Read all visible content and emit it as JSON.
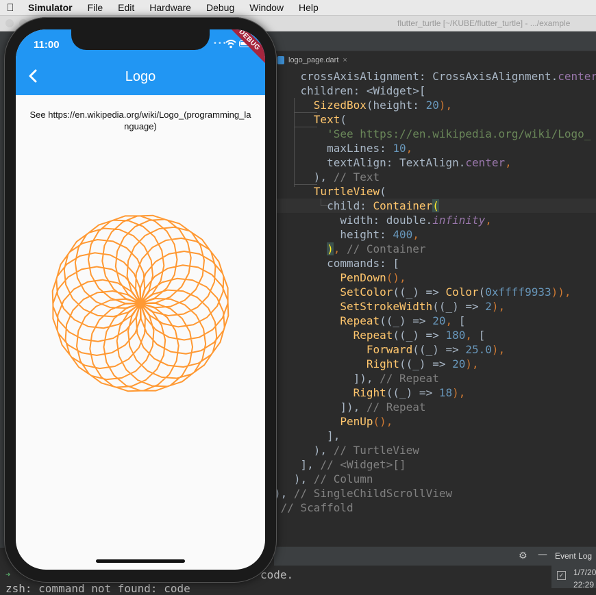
{
  "menubar": {
    "items": [
      "Simulator",
      "File",
      "Edit",
      "Hardware",
      "Debug",
      "Window",
      "Help"
    ]
  },
  "ide": {
    "window_title": "flutter_turtle [~/KUBE/flutter_turtle] - .../example",
    "tab_label": "logo_page.dart",
    "code_lines": [
      [
        {
          "t": "    crossAxisAlignment: CrossAxisAlignment.",
          "c": ""
        },
        {
          "t": "center",
          "c": "c-const"
        },
        {
          "t": ",",
          "c": "c-kw"
        }
      ],
      [
        {
          "t": "    children: <Widget>[",
          "c": ""
        }
      ],
      [
        {
          "t": "      ",
          "c": ""
        },
        {
          "t": "SizedBox",
          "c": "c-cls"
        },
        {
          "t": "(height: ",
          "c": ""
        },
        {
          "t": "20",
          "c": "c-num"
        },
        {
          "t": "),",
          "c": "c-kw"
        }
      ],
      [
        {
          "t": "      ",
          "c": ""
        },
        {
          "t": "Text",
          "c": "c-cls"
        },
        {
          "t": "(",
          "c": ""
        }
      ],
      [
        {
          "t": "        ",
          "c": ""
        },
        {
          "t": "'See https://en.wikipedia.org/wiki/Logo_",
          "c": "c-str"
        }
      ],
      [
        {
          "t": "        maxLines: ",
          "c": ""
        },
        {
          "t": "10",
          "c": "c-num"
        },
        {
          "t": ",",
          "c": "c-kw"
        }
      ],
      [
        {
          "t": "        textAlign: TextAlign.",
          "c": ""
        },
        {
          "t": "center",
          "c": "c-const"
        },
        {
          "t": ",",
          "c": "c-kw"
        }
      ],
      [
        {
          "t": "      ), ",
          "c": ""
        },
        {
          "t": "// Text",
          "c": "c-cmt"
        }
      ],
      [
        {
          "t": "      ",
          "c": ""
        },
        {
          "t": "TurtleView",
          "c": "c-cls"
        },
        {
          "t": "(",
          "c": ""
        }
      ],
      [
        {
          "t": "        child: ",
          "c": ""
        },
        {
          "t": "Container",
          "c": "c-cls"
        },
        {
          "t": "(",
          "c": "c-bracket"
        }
      ],
      [
        {
          "t": "          width: double.",
          "c": ""
        },
        {
          "t": "infinity",
          "c": "c-ital"
        },
        {
          "t": ",",
          "c": "c-kw"
        }
      ],
      [
        {
          "t": "          height: ",
          "c": ""
        },
        {
          "t": "400",
          "c": "c-num"
        },
        {
          "t": ",",
          "c": "c-kw"
        }
      ],
      [
        {
          "t": "        ",
          "c": ""
        },
        {
          "t": ")",
          "c": "c-bracket"
        },
        {
          "t": ", ",
          "c": "c-kw"
        },
        {
          "t": "// Container",
          "c": "c-cmt"
        }
      ],
      [
        {
          "t": "        commands: [",
          "c": ""
        }
      ],
      [
        {
          "t": "          ",
          "c": ""
        },
        {
          "t": "PenDown",
          "c": "c-cls"
        },
        {
          "t": "(),",
          "c": "c-kw"
        }
      ],
      [
        {
          "t": "          ",
          "c": ""
        },
        {
          "t": "SetColor",
          "c": "c-cls"
        },
        {
          "t": "((_) => ",
          "c": ""
        },
        {
          "t": "Color",
          "c": "c-cls"
        },
        {
          "t": "(",
          "c": ""
        },
        {
          "t": "0xffff9933",
          "c": "c-num"
        },
        {
          "t": ")),",
          "c": "c-kw"
        }
      ],
      [
        {
          "t": "          ",
          "c": ""
        },
        {
          "t": "SetStrokeWidth",
          "c": "c-cls"
        },
        {
          "t": "((_) => ",
          "c": ""
        },
        {
          "t": "2",
          "c": "c-num"
        },
        {
          "t": "),",
          "c": "c-kw"
        }
      ],
      [
        {
          "t": "          ",
          "c": ""
        },
        {
          "t": "Repeat",
          "c": "c-cls"
        },
        {
          "t": "((_) => ",
          "c": ""
        },
        {
          "t": "20",
          "c": "c-num"
        },
        {
          "t": ", ",
          "c": "c-kw"
        },
        {
          "t": "[",
          "c": ""
        }
      ],
      [
        {
          "t": "            ",
          "c": ""
        },
        {
          "t": "Repeat",
          "c": "c-cls"
        },
        {
          "t": "((_) => ",
          "c": ""
        },
        {
          "t": "180",
          "c": "c-num"
        },
        {
          "t": ", ",
          "c": "c-kw"
        },
        {
          "t": "[",
          "c": ""
        }
      ],
      [
        {
          "t": "              ",
          "c": ""
        },
        {
          "t": "Forward",
          "c": "c-cls"
        },
        {
          "t": "((_) => ",
          "c": ""
        },
        {
          "t": "25.0",
          "c": "c-num"
        },
        {
          "t": "),",
          "c": "c-kw"
        }
      ],
      [
        {
          "t": "              ",
          "c": ""
        },
        {
          "t": "Right",
          "c": "c-cls"
        },
        {
          "t": "((_) => ",
          "c": ""
        },
        {
          "t": "20",
          "c": "c-num"
        },
        {
          "t": "),",
          "c": "c-kw"
        }
      ],
      [
        {
          "t": "            ]), ",
          "c": ""
        },
        {
          "t": "// Repeat",
          "c": "c-cmt"
        }
      ],
      [
        {
          "t": "            ",
          "c": ""
        },
        {
          "t": "Right",
          "c": "c-cls"
        },
        {
          "t": "((_) => ",
          "c": ""
        },
        {
          "t": "18",
          "c": "c-num"
        },
        {
          "t": "),",
          "c": "c-kw"
        }
      ],
      [
        {
          "t": "          ]), ",
          "c": ""
        },
        {
          "t": "// Repeat",
          "c": "c-cmt"
        }
      ],
      [
        {
          "t": "          ",
          "c": ""
        },
        {
          "t": "PenUp",
          "c": "c-cls"
        },
        {
          "t": "(),",
          "c": "c-kw"
        }
      ],
      [
        {
          "t": "        ],",
          "c": ""
        }
      ],
      [
        {
          "t": "      ), ",
          "c": ""
        },
        {
          "t": "// TurtleView",
          "c": "c-cmt"
        }
      ],
      [
        {
          "t": "    ], ",
          "c": ""
        },
        {
          "t": "// <Widget>[]",
          "c": "c-cmt"
        }
      ],
      [
        {
          "t": "   ), ",
          "c": ""
        },
        {
          "t": "// Column",
          "c": "c-cmt"
        }
      ],
      [
        {
          "t": "), ",
          "c": ""
        },
        {
          "t": "// SingleChildScrollView",
          "c": "c-cmt"
        }
      ],
      [
        {
          "t": " ",
          "c": ""
        },
        {
          "t": "// Scaffold",
          "c": "c-cmt"
        }
      ]
    ],
    "terminal_line1": "code.",
    "terminal_line2": "zsh: command not found: code",
    "event_log_label": "Event Log",
    "event_date": "1/7/20",
    "event_time": "22:29"
  },
  "simulator": {
    "status_time": "11:00",
    "debug_banner": "DEBUG",
    "app_title": "Logo",
    "description": "See https://en.wikipedia.org/wiki/Logo_(programming_language)",
    "turtle": {
      "color": "#ff9933",
      "stroke_width": 2,
      "outer_repeat": 20,
      "inner_repeat": 180,
      "forward": 25.0,
      "inner_right": 20,
      "outer_right": 18
    }
  },
  "colors": {
    "appbar": "#2196f3",
    "debug": "#a6263e"
  }
}
